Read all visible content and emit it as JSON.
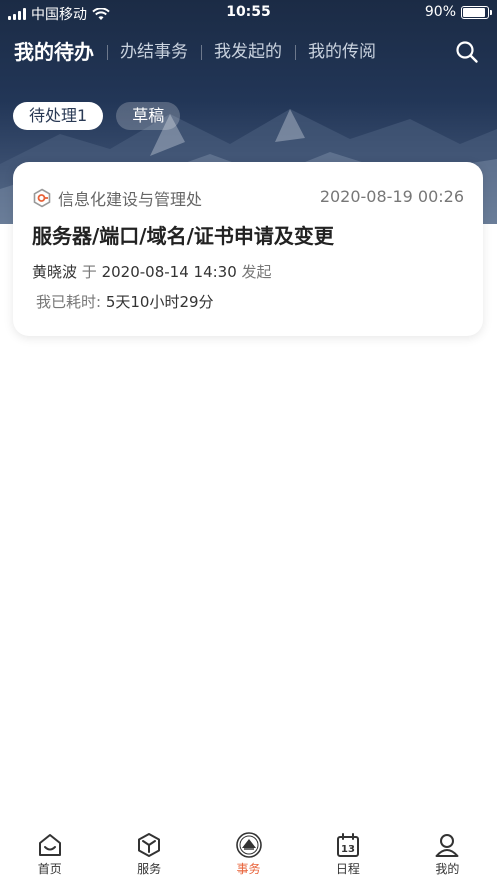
{
  "status_bar": {
    "carrier": "中国移动",
    "time": "10:55",
    "battery": "90%",
    "battery_level": 0.9
  },
  "top_nav": {
    "tabs": [
      {
        "label": "我的待办",
        "active": true
      },
      {
        "label": "办结事务",
        "active": false
      },
      {
        "label": "我发起的",
        "active": false
      },
      {
        "label": "我的传阅",
        "active": false
      }
    ],
    "search_icon": "search-icon"
  },
  "filters": {
    "pending": "待处理1",
    "draft": "草稿"
  },
  "task": {
    "department": "信息化建设与管理处",
    "datetime": "2020-08-19 00:26",
    "title": "服务器/端口/域名/证书申请及变更",
    "initiator_name": "黄晓波",
    "initiator_prefix": "于",
    "initiated_at": "2020-08-14 14:30",
    "initiator_suffix": "发起",
    "elapsed_label": "我已耗时:",
    "elapsed_value": "5天10小时29分"
  },
  "bottom_tabs": [
    {
      "label": "首页",
      "icon": "home-icon"
    },
    {
      "label": "服务",
      "icon": "cube-icon"
    },
    {
      "label": "事务",
      "icon": "affairs-emblem-icon",
      "active": true
    },
    {
      "label": "日程",
      "icon": "calendar-icon",
      "calendar_day": "13"
    },
    {
      "label": "我的",
      "icon": "profile-icon"
    }
  ],
  "colors": {
    "accent": "#e8633a",
    "header_dark": "#1b2b45"
  }
}
